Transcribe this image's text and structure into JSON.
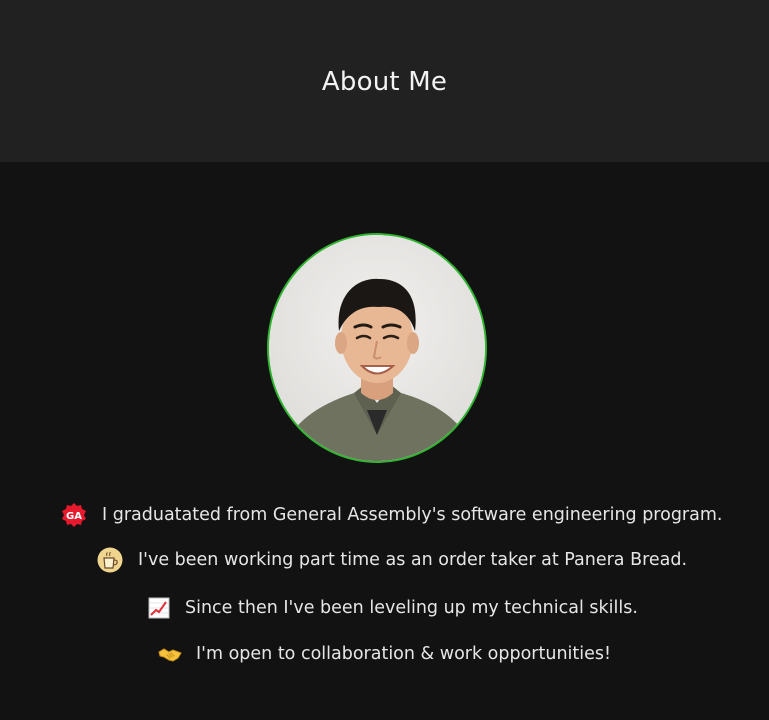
{
  "header": {
    "title": "About Me"
  },
  "profile": {
    "photo_description_icon": "avatar"
  },
  "about": {
    "items": [
      {
        "icon": "general-assembly-logo-icon",
        "text": "I graduatated from General Assembly's software engineering program."
      },
      {
        "icon": "coffee-cup-icon",
        "text": "I've been working part time as an order taker at Panera Bread."
      },
      {
        "icon": "chart-increasing-icon",
        "text": "Since then I've been leveling up my technical skills."
      },
      {
        "icon": "handshake-icon",
        "text": "I'm open to collaboration & work opportunities!"
      }
    ]
  },
  "colors": {
    "header_bg": "#212121",
    "page_bg": "#121212",
    "avatar_border": "#2fb52f",
    "text": "#e6e6e6"
  },
  "logo_text": "GA"
}
